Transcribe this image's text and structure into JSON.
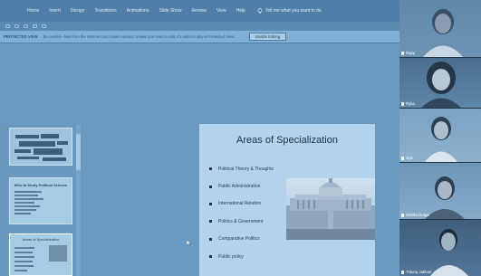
{
  "ribbon": {
    "tabs": [
      "Home",
      "Insert",
      "Design",
      "Transitions",
      "Animations",
      "Slide Show",
      "Review",
      "View",
      "Help"
    ],
    "tell_me": "Tell me what you want to do"
  },
  "protected_bar": {
    "label": "PROTECTED VIEW",
    "message": "Be careful—files from the Internet can contain viruses. Unless you need to edit, it's safer to stay in Protected View.",
    "button": "Enable Editing"
  },
  "slide_panel": {
    "thumb2_title": "Who to Study Political Science",
    "thumb3_title": "Areas of Specialization"
  },
  "slide": {
    "title": "Areas of Specialization",
    "bullets": [
      "Political Theory & Thoughts",
      "Public Administration",
      "International Relation",
      "Politics & Government",
      "Comparative Politics",
      "Public policy"
    ]
  },
  "participants": [
    {
      "name": "Rajaj"
    },
    {
      "name": "Ryka"
    },
    {
      "name": "Jiya"
    },
    {
      "name": "Shalini Durga"
    },
    {
      "name": "Trituraj Jakhari"
    }
  ]
}
